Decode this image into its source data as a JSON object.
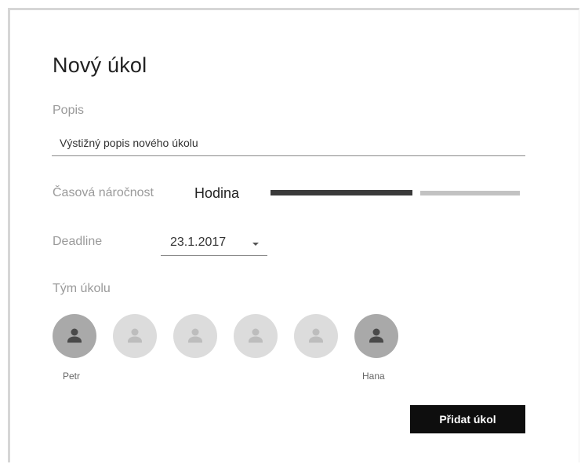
{
  "dialog": {
    "title": "Nový úkol"
  },
  "popis": {
    "label": "Popis",
    "value": "Výstižný popis nového úkolu"
  },
  "casova_narocnost": {
    "label": "Časová náročnost",
    "value": "Hodina",
    "slider_fraction": 0.57
  },
  "deadline": {
    "label": "Deadline",
    "value": "23.1.2017"
  },
  "tym": {
    "label": "Tým úkolu",
    "members": [
      {
        "name": "Petr",
        "selected": true
      },
      {
        "name": "",
        "selected": false
      },
      {
        "name": "",
        "selected": false
      },
      {
        "name": "",
        "selected": false
      },
      {
        "name": "",
        "selected": false
      },
      {
        "name": "Hana",
        "selected": true
      }
    ]
  },
  "actions": {
    "submit_label": "Přidat úkol"
  },
  "icons": {
    "avatar": "person-icon",
    "dropdown": "caret-down-icon"
  },
  "colors": {
    "button_bg": "#0e0e0e",
    "slider_active": "#3a3a3a",
    "slider_rest": "#c2c2c2",
    "avatar_selected": "#a9a9a9",
    "avatar_unselected": "#dcdcdc"
  }
}
